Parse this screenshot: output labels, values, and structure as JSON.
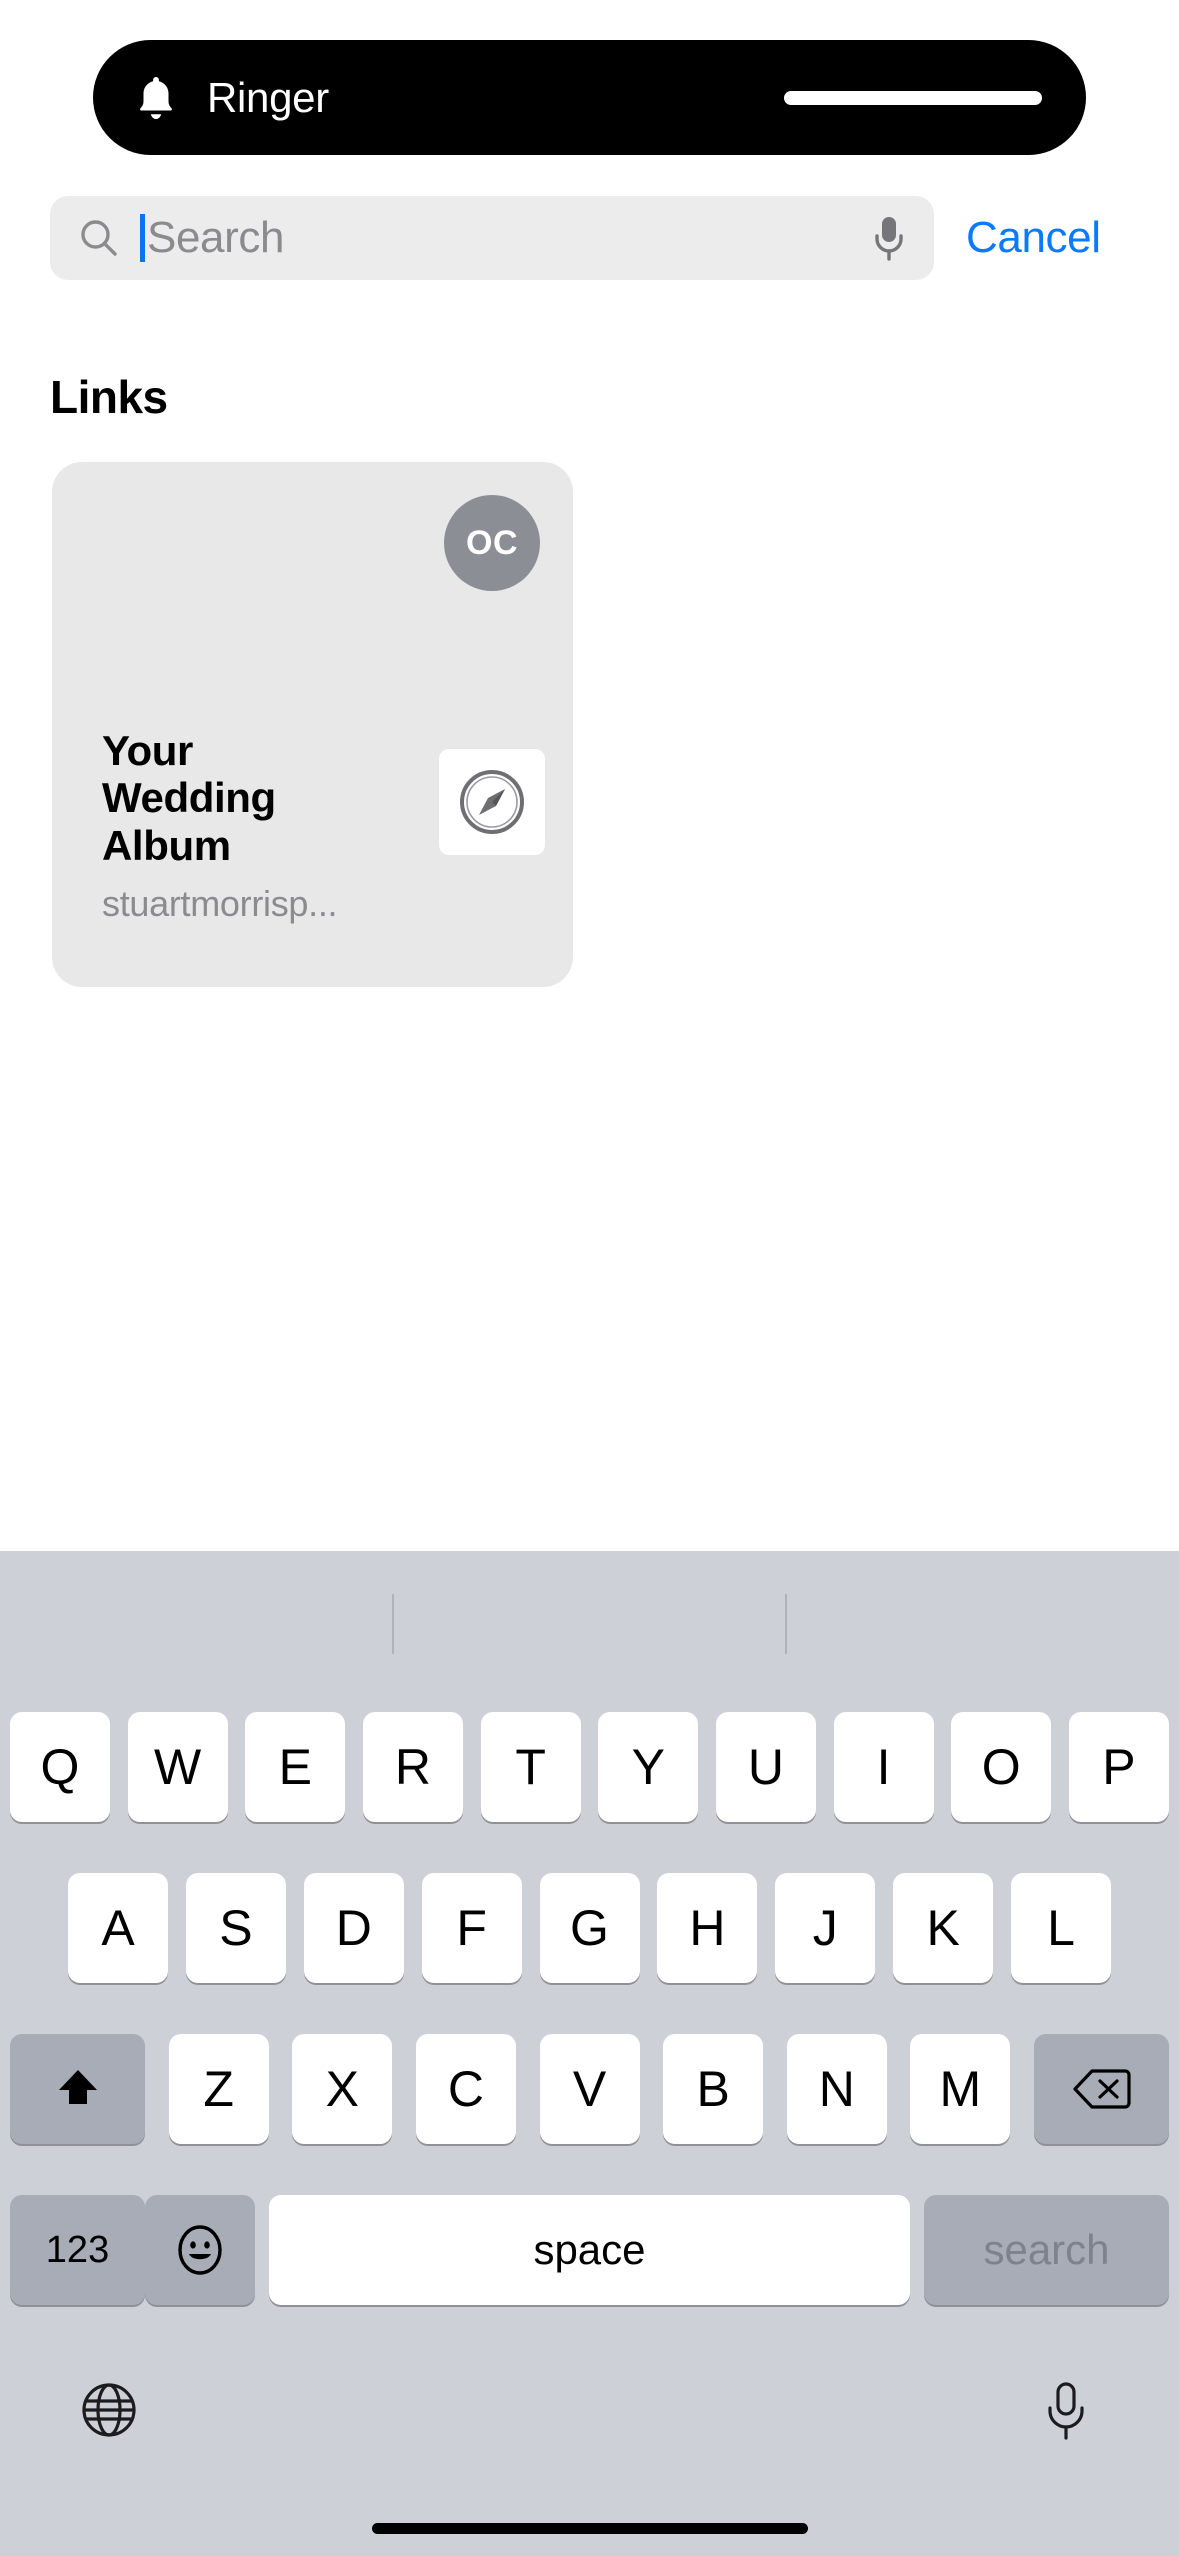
{
  "status_banner": {
    "icon": "bell-icon",
    "title": "Ringer",
    "slider_name": "ringer-volume-slider"
  },
  "search": {
    "placeholder": "Search",
    "value": "",
    "search_icon": "search-icon",
    "mic_icon": "microphone-icon",
    "cancel_label": "Cancel",
    "accent_color": "#0a7aff",
    "caret_color": "#0a74f0",
    "field_background": "#ececec"
  },
  "results": {
    "section_title": "Links",
    "cards": [
      {
        "avatar_initials": "OC",
        "avatar_color": "#8c8e96",
        "title": "Your Wedding Album",
        "subtitle": "stuartmorrisp...",
        "app_icon": "safari-compass-icon",
        "card_background": "#e8e8e8"
      }
    ]
  },
  "keyboard": {
    "background": "#cdd0d7",
    "row1": [
      "Q",
      "W",
      "E",
      "R",
      "T",
      "Y",
      "U",
      "I",
      "O",
      "P"
    ],
    "row2": [
      "A",
      "S",
      "D",
      "F",
      "G",
      "H",
      "J",
      "K",
      "L"
    ],
    "row3_letters": [
      "Z",
      "X",
      "C",
      "V",
      "B",
      "N",
      "M"
    ],
    "shift_icon": "shift-arrow-icon",
    "backspace_icon": "backspace-delete-icon",
    "numbers_label": "123",
    "emoji_icon": "emoji-smiley-icon",
    "space_label": "space",
    "return_label": "search",
    "globe_icon": "globe-language-icon",
    "dictation_icon": "microphone-dictation-icon",
    "key_color": "#ffffff",
    "modifier_key_color": "#a8acb6"
  },
  "home_indicator": "home-indicator-bar"
}
